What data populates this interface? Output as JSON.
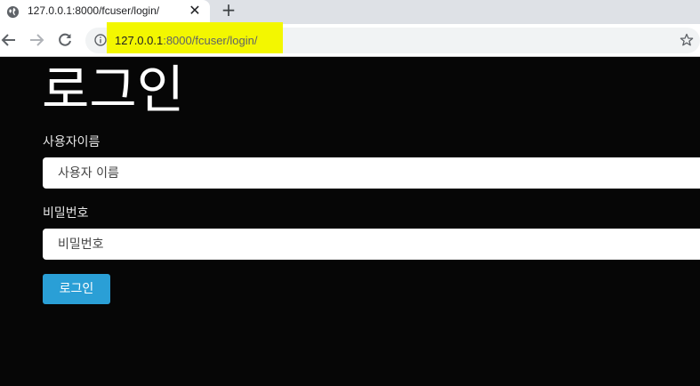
{
  "browser": {
    "tab": {
      "title": "127.0.0.1:8000/fcuser/login/",
      "close_glyph": "✕",
      "icon": "globe-icon"
    },
    "new_tab_glyph": "+",
    "address_bar": {
      "url_host": "127.0.0.1",
      "url_rest": ":8000/fcuser/login/",
      "highlight_color": "#f3f700"
    },
    "icons": [
      "back-arrow-icon",
      "forward-arrow-icon",
      "reload-icon",
      "info-icon",
      "star-icon"
    ]
  },
  "page": {
    "heading": "로그인",
    "username": {
      "label": "사용자이름",
      "placeholder": "사용자 이름"
    },
    "password": {
      "label": "비밀번호",
      "placeholder": "비밀번호"
    },
    "submit_label": "로그인",
    "colors": {
      "background": "#060606",
      "button": "#2a9fd6"
    }
  }
}
